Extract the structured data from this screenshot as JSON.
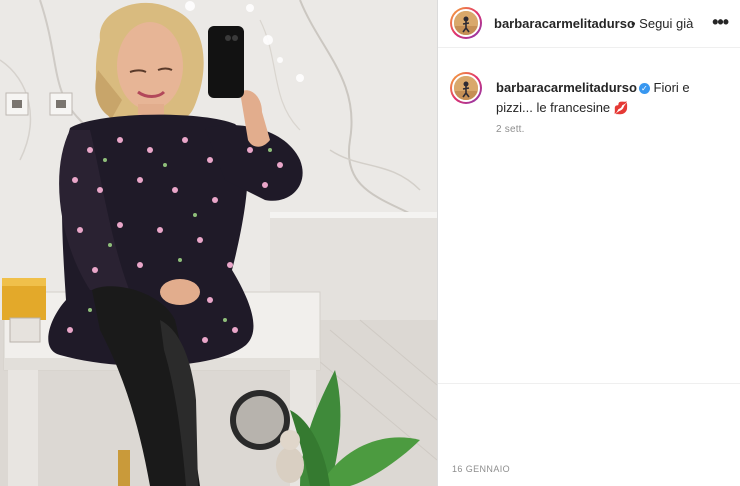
{
  "post": {
    "username": "barbaracarmelitadurso",
    "follow_status": "• Segui già",
    "more_icon": "more-horizontal-icon",
    "caption_user": "barbaracarmelitadurso",
    "verified_icon": "verified-badge-icon",
    "caption_text": "Fiori e pizzi... le francesine",
    "caption_emoji": "💋",
    "relative_time": "2 sett.",
    "date_label": "16 GENNAIO"
  },
  "colors": {
    "verified": "#3897f0",
    "text_primary": "#262626",
    "text_secondary": "#8e8e8e",
    "divider": "#dbdbdb"
  }
}
